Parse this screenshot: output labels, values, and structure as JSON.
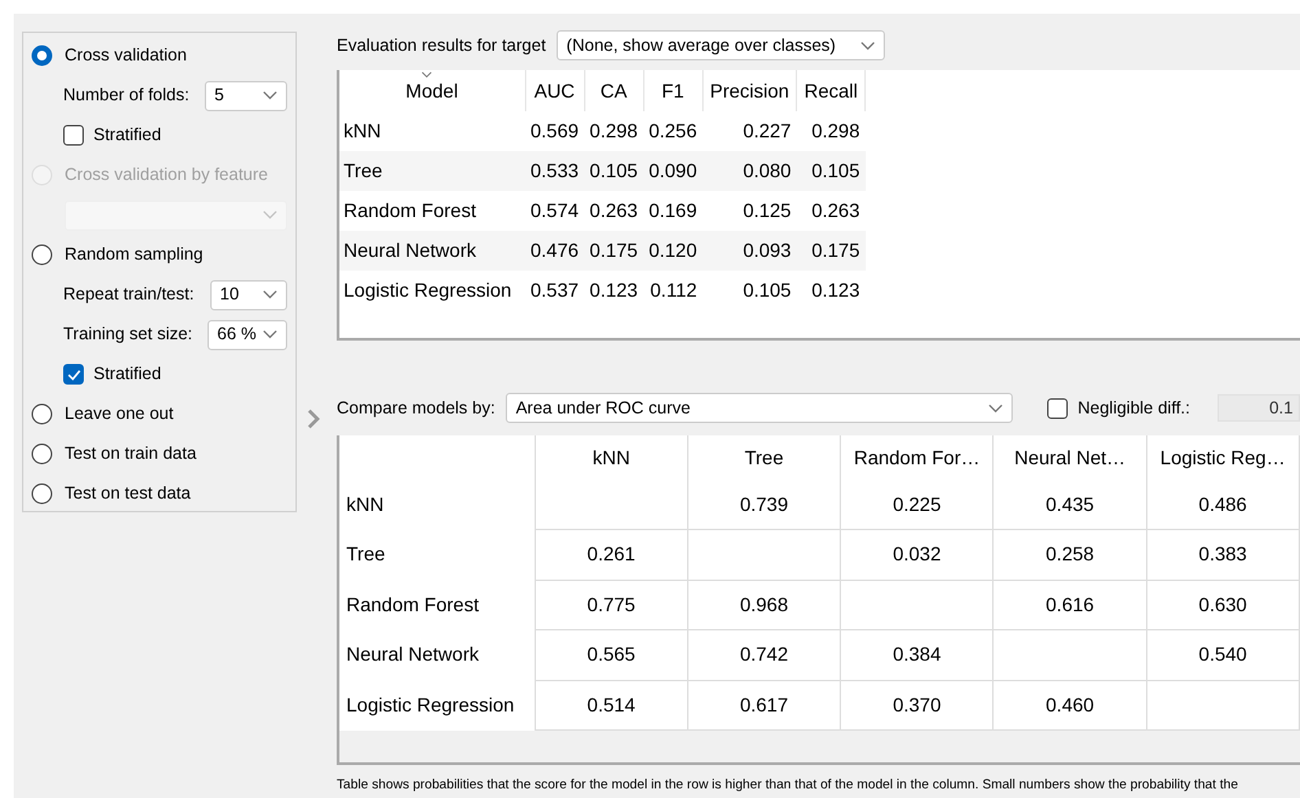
{
  "sampling": {
    "items": [
      {
        "kind": "radio",
        "label": "Cross validation",
        "selected": true,
        "disabled": false
      },
      {
        "kind": "select",
        "label": "Number of folds:",
        "value": "5",
        "disabled": false
      },
      {
        "kind": "checkbox",
        "label": "Stratified",
        "checked": false
      },
      {
        "kind": "radio",
        "label": "Cross validation by feature",
        "selected": false,
        "disabled": true
      },
      {
        "kind": "select",
        "disabled": true
      },
      {
        "kind": "radio",
        "label": "Random sampling",
        "selected": false,
        "disabled": false
      },
      {
        "kind": "select",
        "label": "Repeat train/test:",
        "value": "10",
        "disabled": false
      },
      {
        "kind": "select",
        "label": "Training set size:",
        "value": "66 %",
        "disabled": false
      },
      {
        "kind": "checkbox",
        "label": "Stratified",
        "checked": true
      },
      {
        "kind": "radio",
        "label": "Leave one out",
        "selected": false,
        "disabled": false
      },
      {
        "kind": "radio",
        "label": "Test on train data",
        "selected": false,
        "disabled": false
      },
      {
        "kind": "radio",
        "label": "Test on test data",
        "selected": false,
        "disabled": false
      }
    ]
  },
  "evaluation": {
    "label": "Evaluation results for target",
    "target": "(None, show average over classes)",
    "columns": [
      "Model",
      "AUC",
      "CA",
      "F1",
      "Precision",
      "Recall"
    ],
    "rows": [
      {
        "model": "kNN",
        "values": [
          "0.569",
          "0.298",
          "0.256",
          "0.227",
          "0.298"
        ]
      },
      {
        "model": "Tree",
        "values": [
          "0.533",
          "0.105",
          "0.090",
          "0.080",
          "0.105"
        ]
      },
      {
        "model": "Random Forest",
        "values": [
          "0.574",
          "0.263",
          "0.169",
          "0.125",
          "0.263"
        ]
      },
      {
        "model": "Neural Network",
        "values": [
          "0.476",
          "0.175",
          "0.120",
          "0.093",
          "0.175"
        ]
      },
      {
        "model": "Logistic Regression",
        "values": [
          "0.537",
          "0.123",
          "0.112",
          "0.105",
          "0.123"
        ]
      }
    ]
  },
  "comparison": {
    "label": "Compare models by:",
    "score": "Area under ROC curve",
    "negligible": {
      "label": "Negligible diff.:",
      "checked": false,
      "value": "0.1"
    },
    "columns": [
      "kNN",
      "Tree",
      "Random For…",
      "Neural Net…",
      "Logistic Reg…"
    ],
    "rows": [
      {
        "model": "kNN",
        "cells": [
          null,
          "0.739",
          "0.225",
          "0.435",
          "0.486"
        ]
      },
      {
        "model": "Tree",
        "cells": [
          "0.261",
          null,
          "0.032",
          "0.258",
          "0.383"
        ]
      },
      {
        "model": "Random Forest",
        "cells": [
          "0.775",
          "0.968",
          null,
          "0.616",
          "0.630"
        ]
      },
      {
        "model": "Neural Network",
        "cells": [
          "0.565",
          "0.742",
          "0.384",
          null,
          "0.540"
        ]
      },
      {
        "model": "Logistic Regression",
        "cells": [
          "0.514",
          "0.617",
          "0.370",
          "0.460",
          null
        ]
      }
    ],
    "note": "Table shows probabilities that the score for the model in the row is higher than that of the model in the column. Small numbers show the probability that the"
  }
}
